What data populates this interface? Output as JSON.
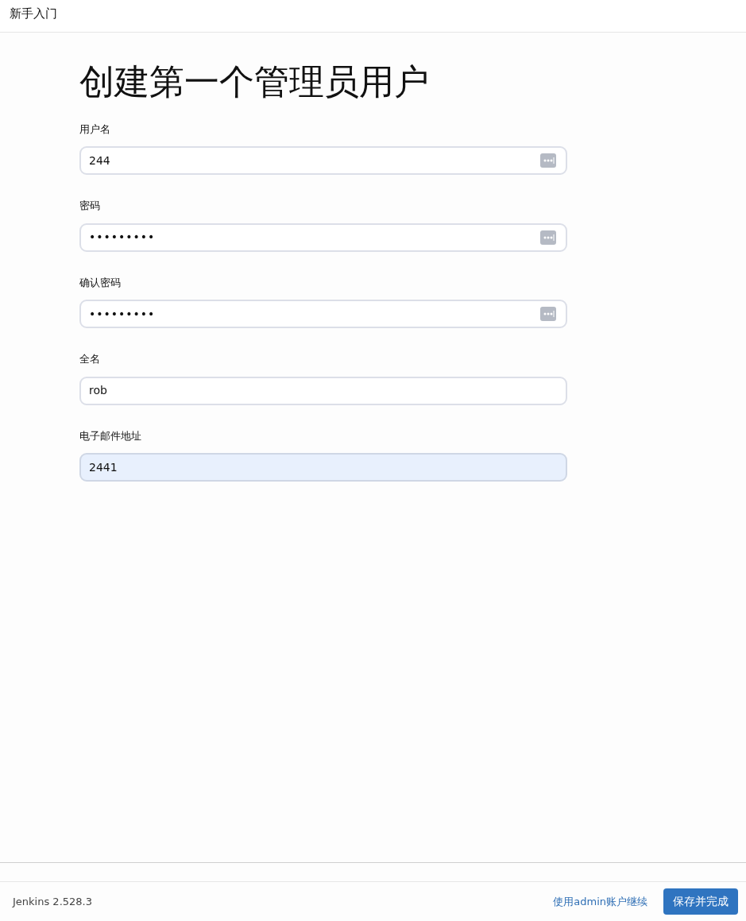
{
  "header": {
    "title": "新手入门"
  },
  "heading": "创建第一个管理员用户",
  "fields": [
    {
      "label": "用户名",
      "value": "244",
      "kind": "text",
      "key_icon": true,
      "autofilled": false
    },
    {
      "label": "密码",
      "value": "•••••••••",
      "kind": "password",
      "key_icon": true,
      "autofilled": false
    },
    {
      "label": "确认密码",
      "value": "•••••••••",
      "kind": "password",
      "key_icon": true,
      "autofilled": false
    },
    {
      "label": "全名",
      "value": "rob",
      "kind": "text",
      "key_icon": false,
      "autofilled": false
    },
    {
      "label": "电子邮件地址",
      "value": "2441",
      "kind": "text",
      "key_icon": false,
      "autofilled": true
    }
  ],
  "footer": {
    "version": "Jenkins 2.528.3",
    "link": "使用admin账户继续",
    "button": "保存并完成"
  }
}
